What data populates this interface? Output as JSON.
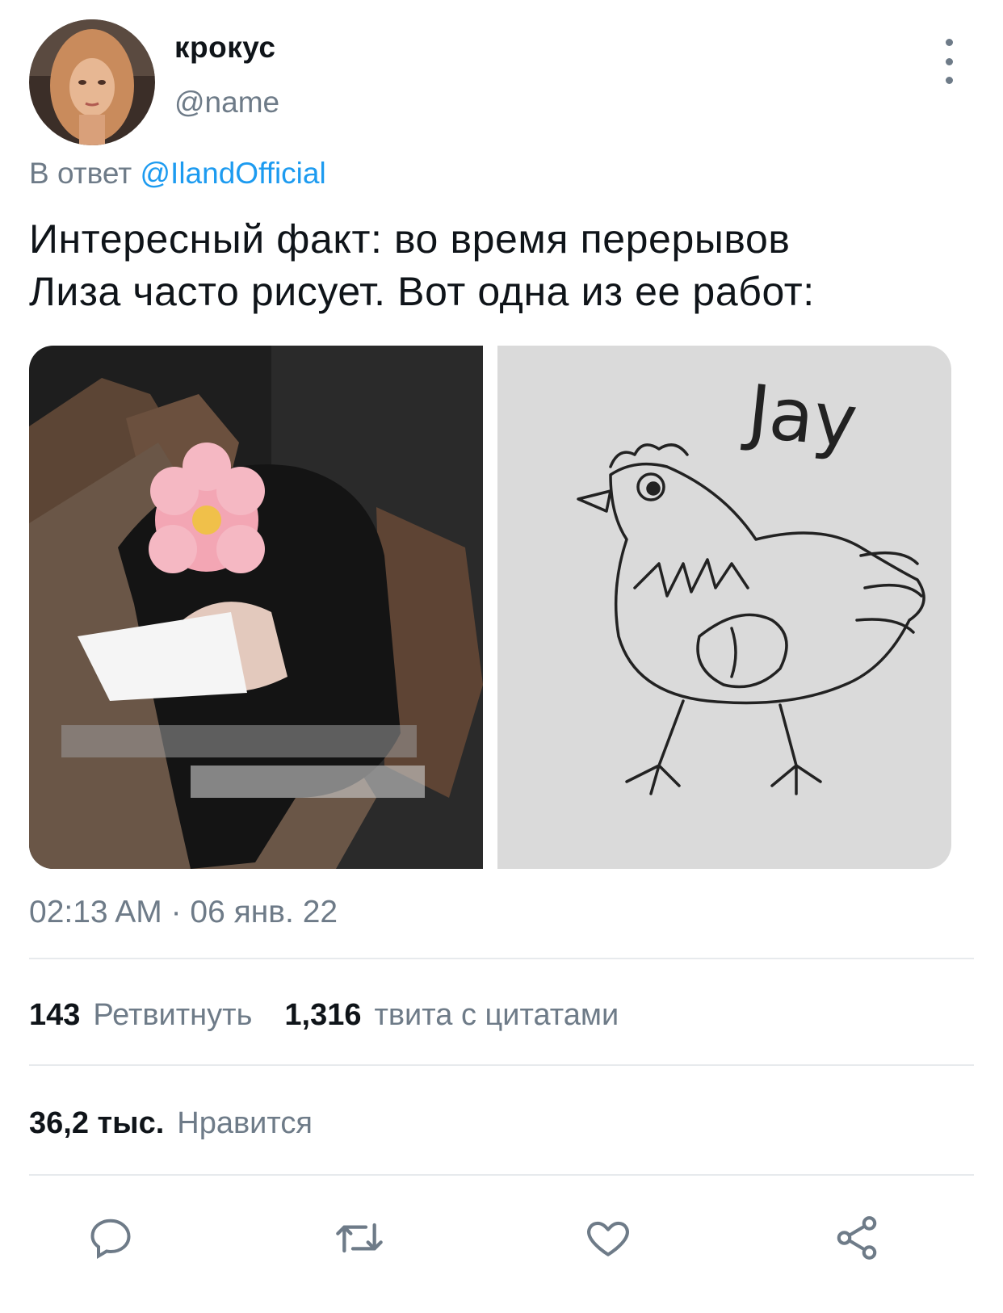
{
  "author": {
    "display_name": "крокус",
    "handle": "@name"
  },
  "reply": {
    "prefix": "В ответ",
    "mention": "@IlandOfficial"
  },
  "tweet": {
    "text": "Интересный факт: во время перерывов\nЛиза часто рисует. Вот одна из ее работ:",
    "timestamp": "02:13 AM · 06 янв. 22"
  },
  "media": {
    "drawing_caption": "Jay"
  },
  "stats": {
    "retweets_count": "143",
    "retweets_label": "Ретвитнуть",
    "quotes_count": "1,316",
    "quotes_label": "твита с цитатами",
    "likes_count": "36,2 тыс.",
    "likes_label": "Нравится"
  },
  "actions": [
    "reply-icon",
    "retweet-icon",
    "like-icon",
    "share-icon"
  ],
  "colors": {
    "accent": "#1d9bf0",
    "secondary_text": "#6e7b88",
    "divider": "#e7eaed"
  }
}
